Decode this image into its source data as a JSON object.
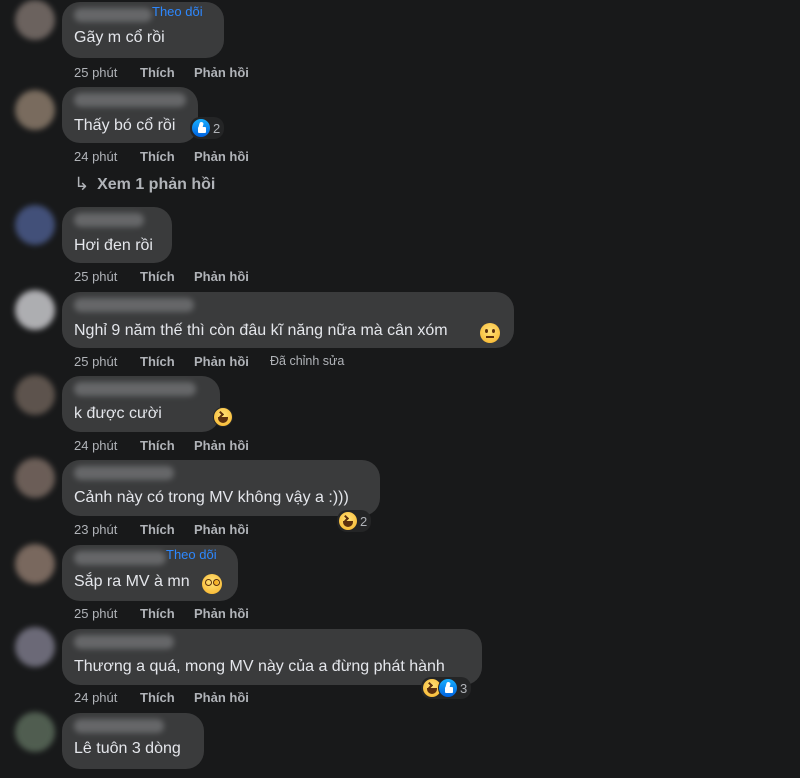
{
  "follow_label": "Theo dõi",
  "like_label": "Thích",
  "reply_label": "Phản hồi",
  "edited_label": "Đã chỉnh sửa",
  "see_replies": "Xem 1 phản hồi",
  "colors": {
    "background": "#18191a",
    "bubble": "#3a3b3c",
    "text": "#e4e6eb",
    "meta": "#b0b3b8",
    "link": "#2d88ff"
  },
  "comments": [
    {
      "text": "Gãy m cổ rồi",
      "time": "25 phút",
      "follow": true
    },
    {
      "text": "Thấy bó cổ rồi",
      "time": "24 phút",
      "reactions": [
        "like-icon"
      ],
      "reaction_count": "2"
    },
    {
      "text": "Hơi đen rồi",
      "time": "25 phút"
    },
    {
      "text": "Nghỉ 9 năm thế thì còn đâu kĩ năng nữa mà cân xóm",
      "time": "25 phút",
      "inline_emoji": "neutral-face-icon",
      "edited": true
    },
    {
      "text": "k được cười",
      "time": "24 phút",
      "inline_emoji": "laughing-face-icon"
    },
    {
      "text": "Cảnh này có trong MV không vậy a :)))",
      "time": "23 phút",
      "reactions": [
        "haha-icon"
      ],
      "reaction_count": "2"
    },
    {
      "text": "Sắp ra MV à mn",
      "time": "25 phút",
      "follow": true,
      "inline_emoji": "dizzy-face-icon"
    },
    {
      "text": "Thương a quá, mong MV này của a đừng phát hành",
      "time": "24 phút",
      "reactions": [
        "haha-icon",
        "like-icon"
      ],
      "reaction_count": "3"
    },
    {
      "text": "Lê tuôn 3 dòng"
    }
  ]
}
